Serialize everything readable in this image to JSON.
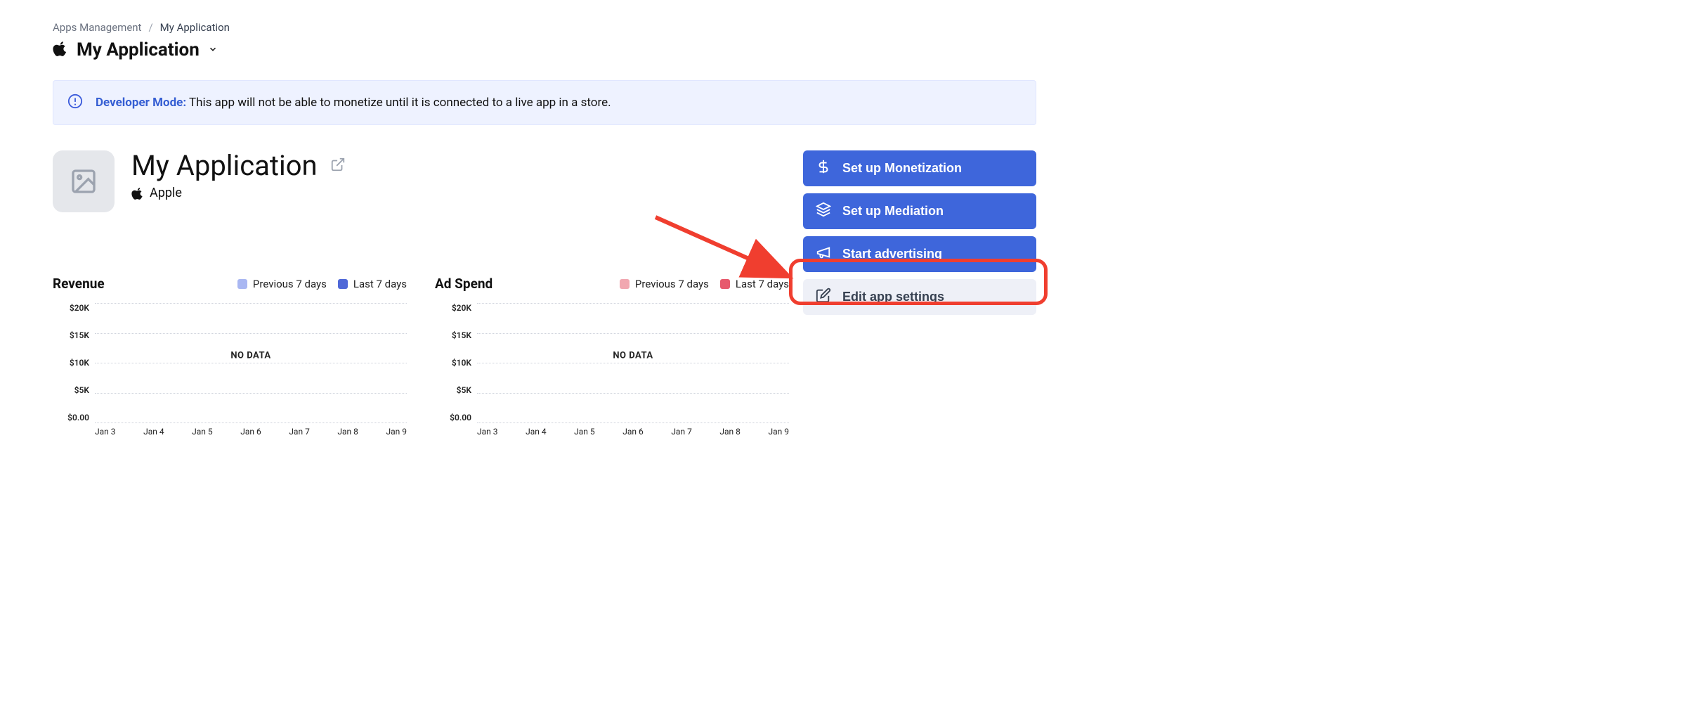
{
  "breadcrumb": {
    "parent": "Apps Management",
    "current": "My Application"
  },
  "page_title": "My Application",
  "alert": {
    "prefix": "Developer Mode:",
    "message": "This app will not be able to monetize until it is connected to a live app in a store."
  },
  "app": {
    "name": "My Application",
    "platform": "Apple"
  },
  "actions": {
    "monetization": "Set up Monetization",
    "mediation": "Set up Mediation",
    "advertising": "Start advertising",
    "edit": "Edit app settings"
  },
  "legend": {
    "prev": "Previous 7 days",
    "last": "Last 7 days"
  },
  "colors": {
    "revenue_prev": "#a9b7f2",
    "revenue_last": "#4f68d8",
    "spend_prev": "#f1a7b0",
    "spend_last": "#e75a6d"
  },
  "chart_data": [
    {
      "type": "line",
      "title": "Revenue",
      "series": [
        {
          "name": "Previous 7 days",
          "values": []
        },
        {
          "name": "Last 7 days",
          "values": []
        }
      ],
      "categories": [
        "Jan 3",
        "Jan 4",
        "Jan 5",
        "Jan 6",
        "Jan 7",
        "Jan 8",
        "Jan 9"
      ],
      "y_ticks": [
        "$20K",
        "$15K",
        "$10K",
        "$5K",
        "$0.00"
      ],
      "ylim": [
        0,
        20000
      ],
      "no_data_label": "NO DATA"
    },
    {
      "type": "line",
      "title": "Ad Spend",
      "series": [
        {
          "name": "Previous 7 days",
          "values": []
        },
        {
          "name": "Last 7 days",
          "values": []
        }
      ],
      "categories": [
        "Jan 3",
        "Jan 4",
        "Jan 5",
        "Jan 6",
        "Jan 7",
        "Jan 8",
        "Jan 9"
      ],
      "y_ticks": [
        "$20K",
        "$15K",
        "$10K",
        "$5K",
        "$0.00"
      ],
      "ylim": [
        0,
        20000
      ],
      "no_data_label": "NO DATA"
    }
  ]
}
